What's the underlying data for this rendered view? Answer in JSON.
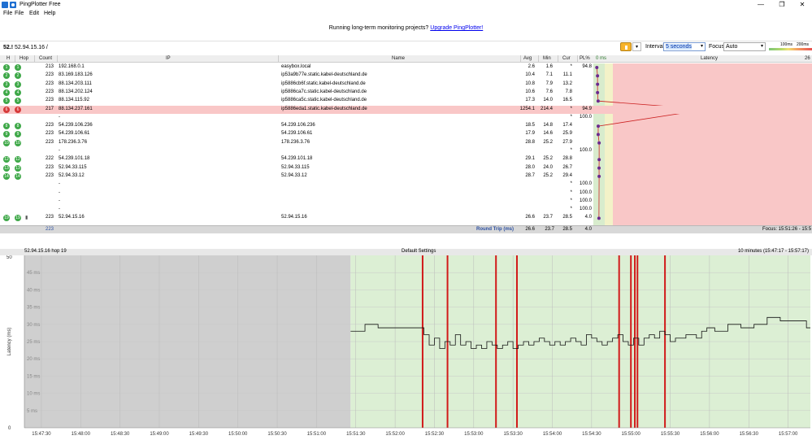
{
  "window": {
    "title": "PingPlotter Free",
    "buttons": [
      "—",
      "❐",
      "✕"
    ]
  },
  "menu": [
    "File",
    "Edit",
    "Help"
  ],
  "banner": {
    "text": "Running long-term monitoring projects?",
    "link": "Upgrade PingPlotter!"
  },
  "target": {
    "short": "52.!",
    "text": "52.94.15.16 /"
  },
  "toolbar": {
    "interval_label": "Interval",
    "interval_value": "5 seconds",
    "focus_label": "Focus",
    "focus_value": "Auto",
    "scale_low": "100ms",
    "scale_high": "200ms"
  },
  "table": {
    "headers": {
      "h": "H",
      "hop": "Hop",
      "count": "Count",
      "ip": "IP",
      "name": "Name",
      "avg": "Avg",
      "min": "Min",
      "cur": "Cur",
      "pl": "PL%",
      "zero": "0 ms",
      "latency": "Latency",
      "max": "26"
    },
    "rows": [
      {
        "h": "1",
        "hop": "1",
        "count": "213",
        "ip": "192.168.0.1",
        "name": "easybox.local",
        "avg": "2.6",
        "min": "1.6",
        "cur": "*",
        "pl": "94.8",
        "status": "ok",
        "lat": 2.6
      },
      {
        "h": "2",
        "hop": "2",
        "count": "223",
        "ip": "83.169.183.126",
        "name": "ip53a9b77e.static.kabel-deutschland.de",
        "avg": "10.4",
        "min": "7.1",
        "cur": "11.1",
        "pl": "",
        "status": "ok",
        "lat": 10.4
      },
      {
        "h": "3",
        "hop": "3",
        "count": "223",
        "ip": "88.134.203.111",
        "name": "ip5886cb6f.static.kabel-deutschland.de",
        "avg": "10.8",
        "min": "7.9",
        "cur": "13.2",
        "pl": "",
        "status": "ok",
        "lat": 10.8
      },
      {
        "h": "4",
        "hop": "4",
        "count": "223",
        "ip": "88.134.202.124",
        "name": "ip5886ca7c.static.kabel-deutschland.de",
        "avg": "10.6",
        "min": "7.6",
        "cur": "7.8",
        "pl": "",
        "status": "ok",
        "lat": 10.6
      },
      {
        "h": "5",
        "hop": "5",
        "count": "223",
        "ip": "88.134.115.92",
        "name": "ip5886ca5c.static.kabel-deutschland.de",
        "avg": "17.3",
        "min": "14.0",
        "cur": "16.5",
        "pl": "",
        "status": "ok",
        "lat": 17.3
      },
      {
        "h": "6",
        "hop": "6",
        "count": "217",
        "ip": "88.134.237.161",
        "name": "ip5886eda1.static.kabel-deutschland.de",
        "avg": "1254.1",
        "min": "214.4",
        "cur": "*",
        "pl": "94.9",
        "status": "bad",
        "lat": 1254.1
      },
      {
        "h": "",
        "hop": "",
        "count": "",
        "ip": "-",
        "name": "",
        "avg": "",
        "min": "",
        "cur": "*",
        "pl": "100.0",
        "status": "none",
        "lat": null
      },
      {
        "h": "8",
        "hop": "8",
        "count": "223",
        "ip": "54.239.106.236",
        "name": "54.239.106.236",
        "avg": "18.5",
        "min": "14.8",
        "cur": "17.4",
        "pl": "",
        "status": "ok",
        "lat": 18.5
      },
      {
        "h": "9",
        "hop": "9",
        "count": "223",
        "ip": "54.239.106.61",
        "name": "54.239.106.61",
        "avg": "17.9",
        "min": "14.6",
        "cur": "25.9",
        "pl": "",
        "status": "ok",
        "lat": 17.9
      },
      {
        "h": "10",
        "hop": "10",
        "count": "223",
        "ip": "178.236.3.76",
        "name": "178.236.3.76",
        "avg": "28.8",
        "min": "25.2",
        "cur": "27.9",
        "pl": "",
        "status": "ok",
        "lat": 28.8
      },
      {
        "h": "",
        "hop": "",
        "count": "",
        "ip": "-",
        "name": "",
        "avg": "",
        "min": "",
        "cur": "*",
        "pl": "100.0",
        "status": "none",
        "lat": null
      },
      {
        "h": "12",
        "hop": "12",
        "count": "222",
        "ip": "54.239.101.18",
        "name": "54.239.101.18",
        "avg": "29.1",
        "min": "25.2",
        "cur": "28.8",
        "pl": "",
        "status": "ok",
        "lat": 29.1
      },
      {
        "h": "13",
        "hop": "13",
        "count": "223",
        "ip": "52.94.33.115",
        "name": "52.94.33.115",
        "avg": "28.0",
        "min": "24.0",
        "cur": "26.7",
        "pl": "",
        "status": "ok",
        "lat": 28.0
      },
      {
        "h": "14",
        "hop": "14",
        "count": "223",
        "ip": "52.94.33.12",
        "name": "52.94.33.12",
        "avg": "28.7",
        "min": "25.2",
        "cur": "29.4",
        "pl": "",
        "status": "ok",
        "lat": 28.7
      },
      {
        "h": "",
        "hop": "",
        "count": "",
        "ip": "-",
        "name": "",
        "avg": "",
        "min": "",
        "cur": "*",
        "pl": "100.0",
        "status": "none",
        "lat": null
      },
      {
        "h": "",
        "hop": "",
        "count": "",
        "ip": "-",
        "name": "",
        "avg": "",
        "min": "",
        "cur": "*",
        "pl": "100.0",
        "status": "none",
        "lat": null
      },
      {
        "h": "",
        "hop": "",
        "count": "",
        "ip": "-",
        "name": "",
        "avg": "",
        "min": "",
        "cur": "*",
        "pl": "100.0",
        "status": "none",
        "lat": null
      },
      {
        "h": "",
        "hop": "",
        "count": "",
        "ip": "-",
        "name": "",
        "avg": "",
        "min": "",
        "cur": "*",
        "pl": "100.0",
        "status": "none",
        "lat": null
      },
      {
        "h": "19",
        "hop": "19",
        "count": "223",
        "ip": "52.94.15.16",
        "name": "52.94.15.16",
        "avg": "26.6",
        "min": "23.7",
        "cur": "28.5",
        "pl": "4.0",
        "status": "ok",
        "lat": 26.6
      }
    ],
    "summary": {
      "count": "223",
      "label": "Round Trip (ms)",
      "avg": "26.6",
      "min": "23.7",
      "cur": "28.5",
      "pl": "4.0",
      "focus": "Focus: 15:51:26 - 15:5"
    }
  },
  "graph": {
    "title_left": "52.94.15.16 hop 19",
    "title_center": "Default Settings",
    "title_right": "10 minutes (15:47:17 - 15:57:17)",
    "ylabel": "Latency (ms)",
    "ymax_label": "50",
    "ymin_label": "0",
    "gridlabels": [
      "45 ms",
      "40 ms",
      "35 ms",
      "30 ms",
      "25 ms",
      "20 ms",
      "15 ms",
      "10 ms",
      "5 ms"
    ],
    "xticks": [
      "15:47:30",
      "15:48:00",
      "15:48:30",
      "15:49:00",
      "15:49:30",
      "15:50:00",
      "15:50:30",
      "15:51:00",
      "15:51:30",
      "15:52:00",
      "15:52:30",
      "15:53:00",
      "15:53:30",
      "15:54:00",
      "15:54:30",
      "15:55:00",
      "15:55:30",
      "15:56:00",
      "15:56:30",
      "15:57:00"
    ]
  },
  "chart_data": {
    "type": "line",
    "ylabel": "Latency (ms)",
    "ylim": [
      0,
      50
    ],
    "x_range": [
      "15:47:17",
      "15:57:17"
    ],
    "nodata_until": "15:51:26",
    "loss_events": [
      "15:52:21",
      "15:52:40",
      "15:53:17",
      "15:53:33",
      "15:54:51",
      "15:55:00",
      "15:55:03",
      "15:55:05",
      "15:55:26"
    ],
    "series": [
      {
        "name": "52.94.15.16 hop 19",
        "x": [
          "15:51:26",
          "15:51:37",
          "15:51:47",
          "15:51:58",
          "15:52:08",
          "15:52:19",
          "15:52:22",
          "15:52:26",
          "15:52:30",
          "15:52:34",
          "15:52:38",
          "15:52:42",
          "15:52:46",
          "15:52:50",
          "15:52:54",
          "15:52:58",
          "15:53:02",
          "15:53:06",
          "15:53:10",
          "15:53:14",
          "15:53:18",
          "15:53:22",
          "15:53:26",
          "15:53:30",
          "15:53:34",
          "15:53:38",
          "15:53:42",
          "15:53:46",
          "15:53:50",
          "15:53:54",
          "15:53:58",
          "15:54:02",
          "15:54:06",
          "15:54:10",
          "15:54:14",
          "15:54:18",
          "15:54:22",
          "15:54:26",
          "15:54:30",
          "15:54:34",
          "15:54:38",
          "15:54:42",
          "15:54:46",
          "15:54:50",
          "15:54:54",
          "15:54:58",
          "15:55:02",
          "15:55:06",
          "15:55:10",
          "15:55:14",
          "15:55:18",
          "15:55:22",
          "15:55:26",
          "15:55:30",
          "15:55:34",
          "15:55:38",
          "15:55:42",
          "15:55:46",
          "15:55:50",
          "15:55:54",
          "15:55:58",
          "15:56:04",
          "15:56:14",
          "15:56:24",
          "15:56:34",
          "15:56:44",
          "15:56:54",
          "15:57:04",
          "15:57:14"
        ],
        "values": [
          28,
          30,
          29,
          29,
          29,
          29,
          27,
          24,
          26,
          23,
          25,
          24,
          27,
          24,
          25,
          23,
          24,
          23,
          25,
          24,
          23,
          24,
          25,
          23,
          24,
          25,
          24,
          25,
          26,
          25,
          24,
          25,
          24,
          25,
          26,
          25,
          24,
          27,
          26,
          25,
          24,
          25,
          26,
          27,
          25,
          24,
          26,
          24,
          26,
          27,
          26,
          28,
          27,
          25,
          26,
          26,
          27,
          27,
          26,
          28,
          29,
          28,
          30,
          29,
          30,
          32,
          31,
          31,
          29
        ]
      }
    ]
  }
}
